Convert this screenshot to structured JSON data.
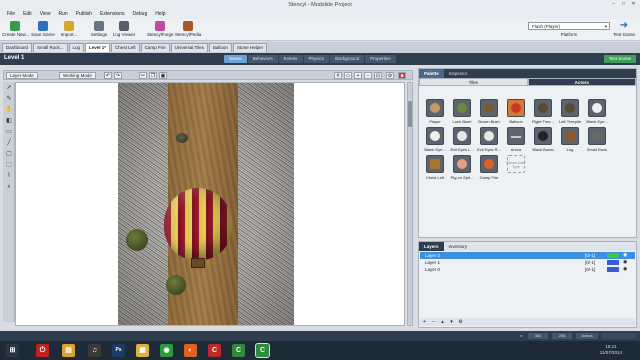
{
  "window": {
    "title": "Stencyl - Mudslide Project"
  },
  "menu": [
    "File",
    "Edit",
    "View",
    "Run",
    "Publish",
    "Extensions",
    "Debug",
    "Help"
  ],
  "toolbar": {
    "buttons": [
      {
        "label": "Create New...",
        "color": "#3c9a4a"
      },
      {
        "label": "Save Game",
        "color": "#2f6fc0"
      },
      {
        "label": "Import...",
        "color": "#d8a430"
      },
      {
        "label": "Settings",
        "color": "#6a7484"
      },
      {
        "label": "Log Viewer",
        "color": "#555e6a"
      },
      {
        "label": "StencylForge",
        "color": "#c04aa0"
      },
      {
        "label": "StencylPedia",
        "color": "#a8552a"
      }
    ],
    "platform_value": "Flash (Player)",
    "platform_label": "Platform",
    "test_game_label": "Test Game"
  },
  "tabs": [
    "Dashboard",
    "Small Rock...",
    "Log",
    "Level 1*",
    "Chest Left",
    "Camp Fire",
    "Universal Tiles",
    "Balloon",
    "Stone Helper"
  ],
  "active_tab_index": 3,
  "subheader": {
    "level_title": "Level 1",
    "scene_tabs": [
      "Scene",
      "Behaviors",
      "Events",
      "Physics",
      "Background",
      "Properties"
    ],
    "active_scene_tab": 0,
    "test_scene_label": "Test Scene"
  },
  "canvas_toolbar": {
    "layer_mode": "Layer Mode",
    "working_mode": "Working Mode"
  },
  "palette": {
    "tabs": [
      "Palette",
      "Inspector"
    ],
    "subtabs": [
      "Tiles",
      "Actors"
    ],
    "active_subtab": 1,
    "actors": [
      {
        "name": "Player",
        "color": "#c89a60"
      },
      {
        "name": "Lush Bush",
        "color": "#6d8a3c"
      },
      {
        "name": "Brown Bush",
        "color": "#7a5a2c"
      },
      {
        "name": "Balloon",
        "color": "#c23a2a"
      },
      {
        "name": "Right Tree...",
        "color": "#5a4a30"
      },
      {
        "name": "Left Treepile",
        "color": "#5a4a30"
      },
      {
        "name": "Blank Eye...",
        "color": "#f0f0f0"
      },
      {
        "name": "Blank Eye...",
        "color": "#f0f0f0"
      },
      {
        "name": "Evil Eyes L...",
        "color": "#e8e8e8"
      },
      {
        "name": "Evil Eyes R...",
        "color": "#e8e8e8"
      },
      {
        "name": "Arrow",
        "color": "#c8c8c8"
      },
      {
        "name": "Black Bomb",
        "color": "#222222"
      },
      {
        "name": "Log",
        "color": "#8a5a2a"
      },
      {
        "name": "Small Rock",
        "color": "#6a6a6a"
      },
      {
        "name": "Chest Left",
        "color": "#a8762a"
      },
      {
        "name": "Pig on Spit...",
        "color": "#e0a080"
      },
      {
        "name": "Camp Fire",
        "color": "#e06020"
      }
    ],
    "create_actor_label": "Create Actor Type"
  },
  "layers": {
    "tabs": [
      "Layers",
      "Inventory"
    ],
    "rows": [
      {
        "name": "Layer 2",
        "count": "[0/-1]",
        "color": "#36c84a",
        "selected": true
      },
      {
        "name": "Layer 1",
        "count": "[0/-1]",
        "color": "#3a5ad8",
        "selected": false
      },
      {
        "name": "Layer 0",
        "count": "[0/-1]",
        "color": "#3a5ad8",
        "selected": false
      }
    ]
  },
  "status": {
    "zoom_label": "x:",
    "x": "384",
    "y": "256",
    "mode_label": "Actors"
  },
  "taskbar": {
    "time": "15:21",
    "date": "11/07/2014",
    "apps": [
      {
        "name": "power-icon",
        "glyph": "⏻",
        "color": "#c42020"
      },
      {
        "name": "folder-icon",
        "glyph": "▤",
        "color": "#d8a430"
      },
      {
        "name": "music-icon",
        "glyph": "♫",
        "color": "#3a3a3a"
      },
      {
        "name": "photoshop-icon",
        "glyph": "Ps",
        "color": "#1a3a6a"
      },
      {
        "name": "explorer-icon",
        "glyph": "▦",
        "color": "#e0b040"
      },
      {
        "name": "chrome-icon",
        "glyph": "◉",
        "color": "#2a9a3a"
      },
      {
        "name": "firefox-icon",
        "glyph": "◐",
        "color": "#e06020"
      },
      {
        "name": "app-c-icon",
        "glyph": "C",
        "color": "#c02828"
      },
      {
        "name": "app-c2-icon",
        "glyph": "C",
        "color": "#2f8a3a"
      },
      {
        "name": "app-c3-icon",
        "glyph": "C",
        "color": "#2f8a3a"
      }
    ]
  }
}
